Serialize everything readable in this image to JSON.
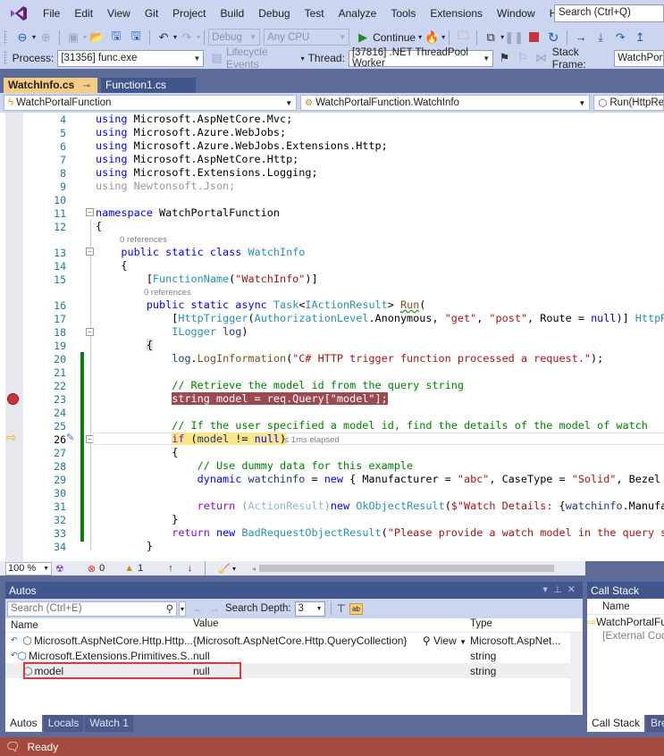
{
  "menu": {
    "items": [
      "File",
      "Edit",
      "View",
      "Git",
      "Project",
      "Build",
      "Debug",
      "Test",
      "Analyze",
      "Tools",
      "Extensions",
      "Window",
      "Help"
    ],
    "search_placeholder": "Search (Ctrl+Q)"
  },
  "toolbar": {
    "config": "Debug",
    "platform": "Any CPU",
    "continue_label": "Continue",
    "process_label": "Process:",
    "process_value": "[31356] func.exe",
    "lifecycle_label": "Lifecycle Events",
    "thread_label": "Thread:",
    "thread_value": "[37816] .NET ThreadPool Worker",
    "stack_frame_label": "Stack Frame:",
    "stack_frame_value": "WatchPortalFunction"
  },
  "tabs": [
    {
      "label": "WatchInfo.cs",
      "active": true
    },
    {
      "label": "Function1.cs",
      "active": false
    }
  ],
  "navbar": {
    "project": "WatchPortalFunction",
    "type": "WatchPortalFunction.WatchInfo",
    "member": "Run(HttpRequest req, ILogger log)"
  },
  "editor": {
    "codelens_13": "0 references",
    "codelens_16": "0 references",
    "elapsed": "≤ 1ms elapsed",
    "lines": {
      "4": "4",
      "5": "5",
      "6": "6",
      "7": "7",
      "8": "8",
      "9": "9",
      "10": "10",
      "11": "11",
      "12": "12",
      "13": "13",
      "14": "14",
      "15": "15",
      "16": "16",
      "17": "17",
      "18": "18",
      "19": "19",
      "20": "20",
      "21": "21",
      "22": "22",
      "23": "23",
      "24": "24",
      "25": "25",
      "26": "26",
      "27": "27",
      "28": "28",
      "29": "29",
      "30": "30",
      "31": "31",
      "32": "32",
      "33": "33",
      "34": "34"
    }
  },
  "editor_status": {
    "zoom": "100 %",
    "errors": "0",
    "warnings": "1"
  },
  "autos": {
    "title": "Autos",
    "search_placeholder": "Search (Ctrl+E)",
    "search_depth_label": "Search Depth:",
    "search_depth_value": "3",
    "columns": [
      "Name",
      "Value",
      "Type"
    ],
    "rows": [
      {
        "name": "Microsoft.AspNetCore.Http.Http...",
        "value": "{Microsoft.AspNetCore.Http.QueryCollection}",
        "view": "View",
        "type": "Microsoft.AspNet..."
      },
      {
        "name": "Microsoft.Extensions.Primitives.S...",
        "value": "null",
        "type": "string"
      },
      {
        "name": "model",
        "value": "null",
        "type": "string"
      }
    ],
    "tabs": [
      "Autos",
      "Locals",
      "Watch 1"
    ]
  },
  "callstack": {
    "title": "Call Stack",
    "column": "Name",
    "rows": [
      "WatchPortalFunction.dll!WatchPortalFunction.WatchInfo.Run",
      "[External Code]"
    ],
    "tabs": [
      "Call Stack",
      "Breakpoints"
    ]
  },
  "status": {
    "text": "Ready"
  }
}
